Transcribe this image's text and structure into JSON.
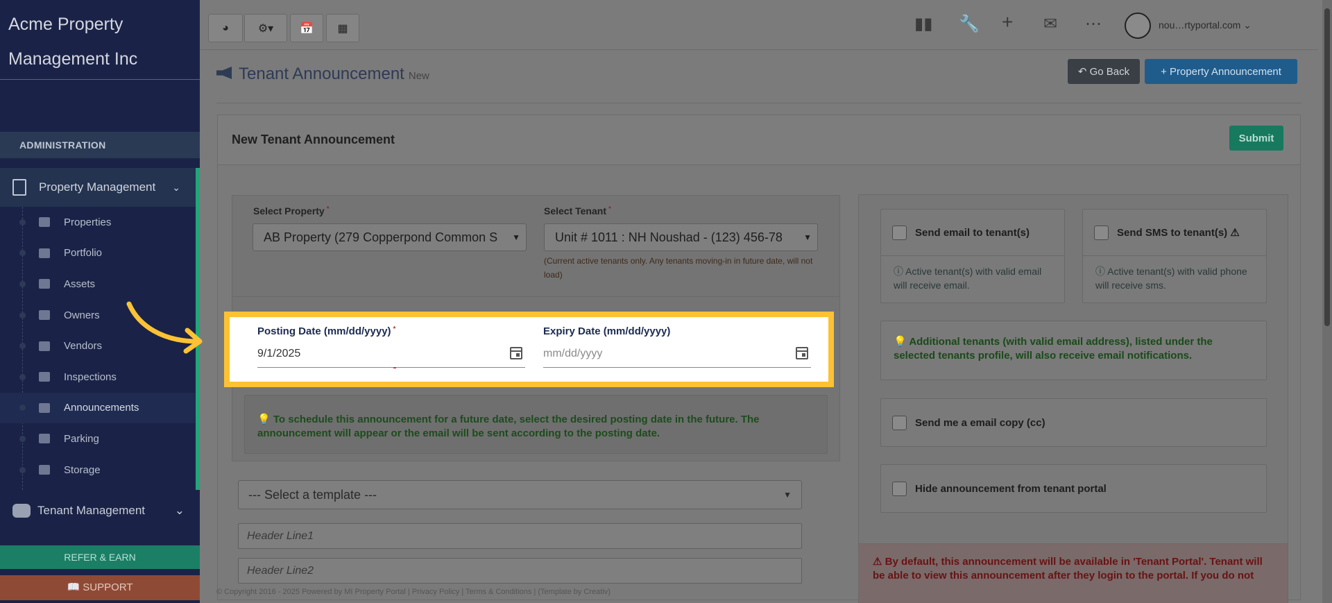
{
  "sidebar": {
    "brand": "Acme Property Management Inc",
    "admin_label": "ADMINISTRATION",
    "pm_label": "Property Management",
    "items": [
      {
        "label": "Properties"
      },
      {
        "label": "Portfolio"
      },
      {
        "label": "Assets"
      },
      {
        "label": "Owners"
      },
      {
        "label": "Vendors"
      },
      {
        "label": "Inspections"
      },
      {
        "label": "Announcements"
      },
      {
        "label": "Parking"
      },
      {
        "label": "Storage"
      }
    ],
    "tm_label": "Tenant Management",
    "refer_label": "REFER & EARN",
    "support_label": "SUPPORT"
  },
  "topbar": {
    "user_email": "nou…rtyportal.com"
  },
  "page": {
    "title": "Tenant Announcement",
    "subtitle": "New",
    "go_back": "Go Back",
    "property_announcement": "+ Property Announcement"
  },
  "card": {
    "title": "New Tenant Announcement",
    "submit": "Submit"
  },
  "form": {
    "property_label": "Select Property",
    "property_value": "AB Property (279 Copperpond Common S",
    "tenant_label": "Select Tenant",
    "tenant_value": "Unit # 1011 : NH Noushad - (123) 456-78",
    "tenant_hint": "(Current active tenants only. Any tenants moving-in in future date, will not load)",
    "posting_label": "Posting Date (mm/dd/yyyy)",
    "posting_value": "9/1/2025",
    "expiry_label": "Expiry Date (mm/dd/yyyy)",
    "expiry_placeholder": "mm/dd/yyyy",
    "schedule_note": "To schedule this announcement for a future date, select the desired posting date in the future. The announcement will appear or the email will be sent according to the posting date.",
    "template_placeholder": "--- Select a template ---",
    "header1_placeholder": "Header Line1",
    "header2_placeholder": "Header Line2"
  },
  "options": {
    "email_label": "Send email to tenant(s)",
    "email_note": "Active tenant(s) with valid email will receive email.",
    "sms_label": "Send SMS to tenant(s)",
    "sms_note": "Active tenant(s) with valid phone will receive sms.",
    "additional_note": "Additional tenants (with valid email address), listed under the selected tenants profile, will also receive email notifications.",
    "cc_label": "Send me a email copy (cc)",
    "hide_label": "Hide announcement from tenant portal",
    "portal_note": "By default, this announcement will be available in 'Tenant Portal'. Tenant will be able to view this announcement after they login to the portal. If you do not"
  },
  "footer": {
    "text": "© Copyright 2016 - 2025 Powered by MI Property Portal | Privacy Policy | Terms & Conditions | (Template by Creativ)"
  },
  "colors": {
    "highlight": "#fcc233",
    "sidebar_bg": "#1a2347",
    "accent_green": "#22a67a"
  }
}
